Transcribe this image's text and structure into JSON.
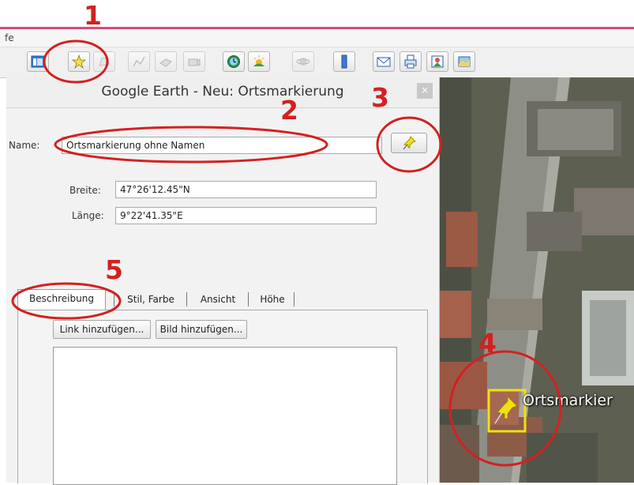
{
  "menu": {
    "visible_text": "fe"
  },
  "toolbar": {
    "buttons": [
      {
        "name": "sidebar-toggle-button",
        "icon": "sidebar-icon"
      },
      {
        "name": "add-placemark-button",
        "icon": "pushpin-star-icon"
      },
      {
        "name": "add-polygon-button",
        "icon": "polygon-icon"
      },
      {
        "name": "add-path-button",
        "icon": "path-icon"
      },
      {
        "name": "add-image-overlay-button",
        "icon": "image-overlay-icon"
      },
      {
        "name": "record-tour-button",
        "icon": "camera-icon"
      },
      {
        "name": "historical-imagery-button",
        "icon": "clock-icon"
      },
      {
        "name": "sunlight-button",
        "icon": "sun-icon"
      },
      {
        "name": "switch-planet-button",
        "icon": "planet-icon"
      },
      {
        "name": "ruler-button",
        "icon": "ruler-icon"
      },
      {
        "name": "email-button",
        "icon": "envelope-icon"
      },
      {
        "name": "print-button",
        "icon": "printer-icon"
      },
      {
        "name": "save-image-button",
        "icon": "save-image-icon"
      },
      {
        "name": "view-in-maps-button",
        "icon": "map-icon"
      }
    ]
  },
  "dialog": {
    "title": "Google Earth - Neu: Ortsmarkierung",
    "close_label": "×",
    "name_label": "Name:",
    "name_value": "Ortsmarkierung ohne Namen",
    "lat_label": "Breite:",
    "lat_value": "47°26'12.45\"N",
    "lon_label": "Länge:",
    "lon_value": "9°22'41.35\"E",
    "tabs": [
      "Beschreibung",
      "Stil, Farbe",
      "Ansicht",
      "Höhe"
    ],
    "link_button": "Link hinzufügen...",
    "image_button": "Bild hinzufügen..."
  },
  "map": {
    "placemark_label": "Ortsmarkier"
  },
  "annotations": [
    "1",
    "2",
    "3",
    "4",
    "5"
  ],
  "colors": {
    "annotation": "#d42020",
    "accent_line": "#d94b7b",
    "pin": "#f2e010"
  }
}
